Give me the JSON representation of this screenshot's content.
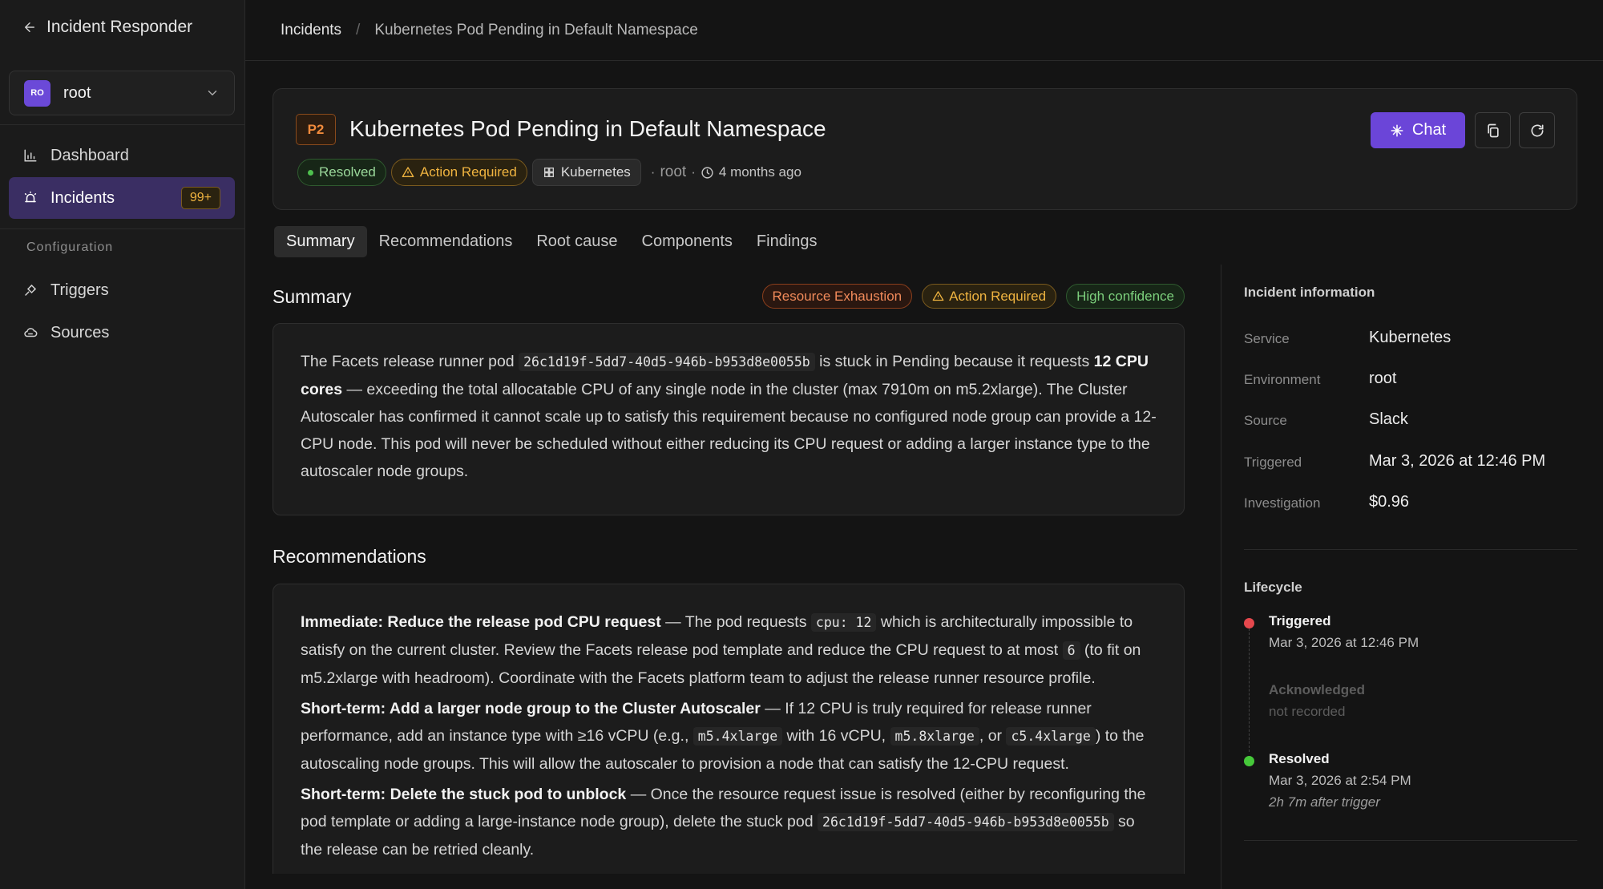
{
  "sidebar": {
    "back_label": "Incident Responder",
    "org": {
      "initials": "RO",
      "name": "root"
    },
    "nav": [
      {
        "label": "Dashboard",
        "icon": "chart-icon"
      },
      {
        "label": "Incidents",
        "icon": "alarm-icon",
        "badge": "99+"
      }
    ],
    "config_label": "Configuration",
    "config_items": [
      {
        "label": "Triggers",
        "icon": "plug-icon"
      },
      {
        "label": "Sources",
        "icon": "cloud-icon"
      }
    ]
  },
  "breadcrumb": {
    "parent": "Incidents",
    "separator": "/",
    "current": "Kubernetes Pod Pending in Default Namespace"
  },
  "incident": {
    "priority": "P2",
    "title": "Kubernetes Pod Pending in Default Namespace",
    "status": "Resolved",
    "action": "Action Required",
    "service": "Kubernetes",
    "org": "root",
    "age": "4 months ago",
    "chat_label": "Chat"
  },
  "tabs": [
    "Summary",
    "Recommendations",
    "Root cause",
    "Components",
    "Findings"
  ],
  "summary": {
    "heading": "Summary",
    "tags": [
      "Resource Exhaustion",
      "Action Required",
      "High confidence"
    ],
    "text_1": "The Facets release runner pod ",
    "code_1": "26c1d19f-5dd7-40d5-946b-b953d8e0055b",
    "text_2": " is stuck in Pending because it requests ",
    "bold_1": "12 CPU cores",
    "text_3": " — exceeding the total allocatable CPU of any single node in the cluster (max 7910m on m5.2xlarge). The Cluster Autoscaler has confirmed it cannot scale up to satisfy this requirement because no configured node group can provide a 12-CPU node. This pod will never be scheduled without either reducing its CPU request or adding a larger instance type to the autoscaler node groups."
  },
  "recommendations": {
    "heading": "Recommendations",
    "items": [
      {
        "title": "Immediate: Reduce the release pod CPU request",
        "t1": " — The pod requests ",
        "c1": "cpu: 12",
        "t2": " which is architecturally impossible to satisfy on the current cluster. Review the Facets release pod template and reduce the CPU request to at most ",
        "c2": "6",
        "t3": " (to fit on m5.2xlarge with headroom). Coordinate with the Facets platform team to adjust the release runner resource profile."
      },
      {
        "title": "Short-term: Add a larger node group to the Cluster Autoscaler",
        "t1": " — If 12 CPU is truly required for release runner performance, add an instance type with ≥16 vCPU (e.g., ",
        "c1": "m5.4xlarge",
        "t2": " with 16 vCPU, ",
        "c2": "m5.8xlarge",
        "t3": ", or ",
        "c3": "c5.4xlarge",
        "t4": ") to the autoscaling node groups. This will allow the autoscaler to provision a node that can satisfy the 12-CPU request."
      },
      {
        "title": "Short-term: Delete the stuck pod to unblock",
        "t1": " — Once the resource request issue is resolved (either by reconfiguring the pod template or adding a large-instance node group), delete the stuck pod ",
        "c1": "26c1d19f-5dd7-40d5-946b-b953d8e0055b",
        "t2": " so the release can be retried cleanly."
      }
    ]
  },
  "info": {
    "title": "Incident information",
    "rows": [
      {
        "label": "Service",
        "value": "Kubernetes"
      },
      {
        "label": "Environment",
        "value": "root"
      },
      {
        "label": "Source",
        "value": "Slack"
      },
      {
        "label": "Triggered",
        "value": "Mar 3, 2026 at 12:46 PM"
      },
      {
        "label": "Investigation",
        "value": "$0.96"
      }
    ]
  },
  "lifecycle": {
    "title": "Lifecycle",
    "events": [
      {
        "name": "Triggered",
        "time": "Mar 3, 2026 at 12:46 PM",
        "color": "#e5484d"
      },
      {
        "name": "Acknowledged",
        "time": "not recorded"
      },
      {
        "name": "Resolved",
        "time": "Mar 3, 2026 at 2:54 PM",
        "note": "2h 7m after trigger",
        "color": "#46c93a"
      }
    ]
  },
  "colors": {
    "accent": "#6b45d8",
    "active_nav": "#3a2e63",
    "warning": "#f0b440",
    "success": "#4ec04e",
    "priority": "#f08a3c"
  }
}
